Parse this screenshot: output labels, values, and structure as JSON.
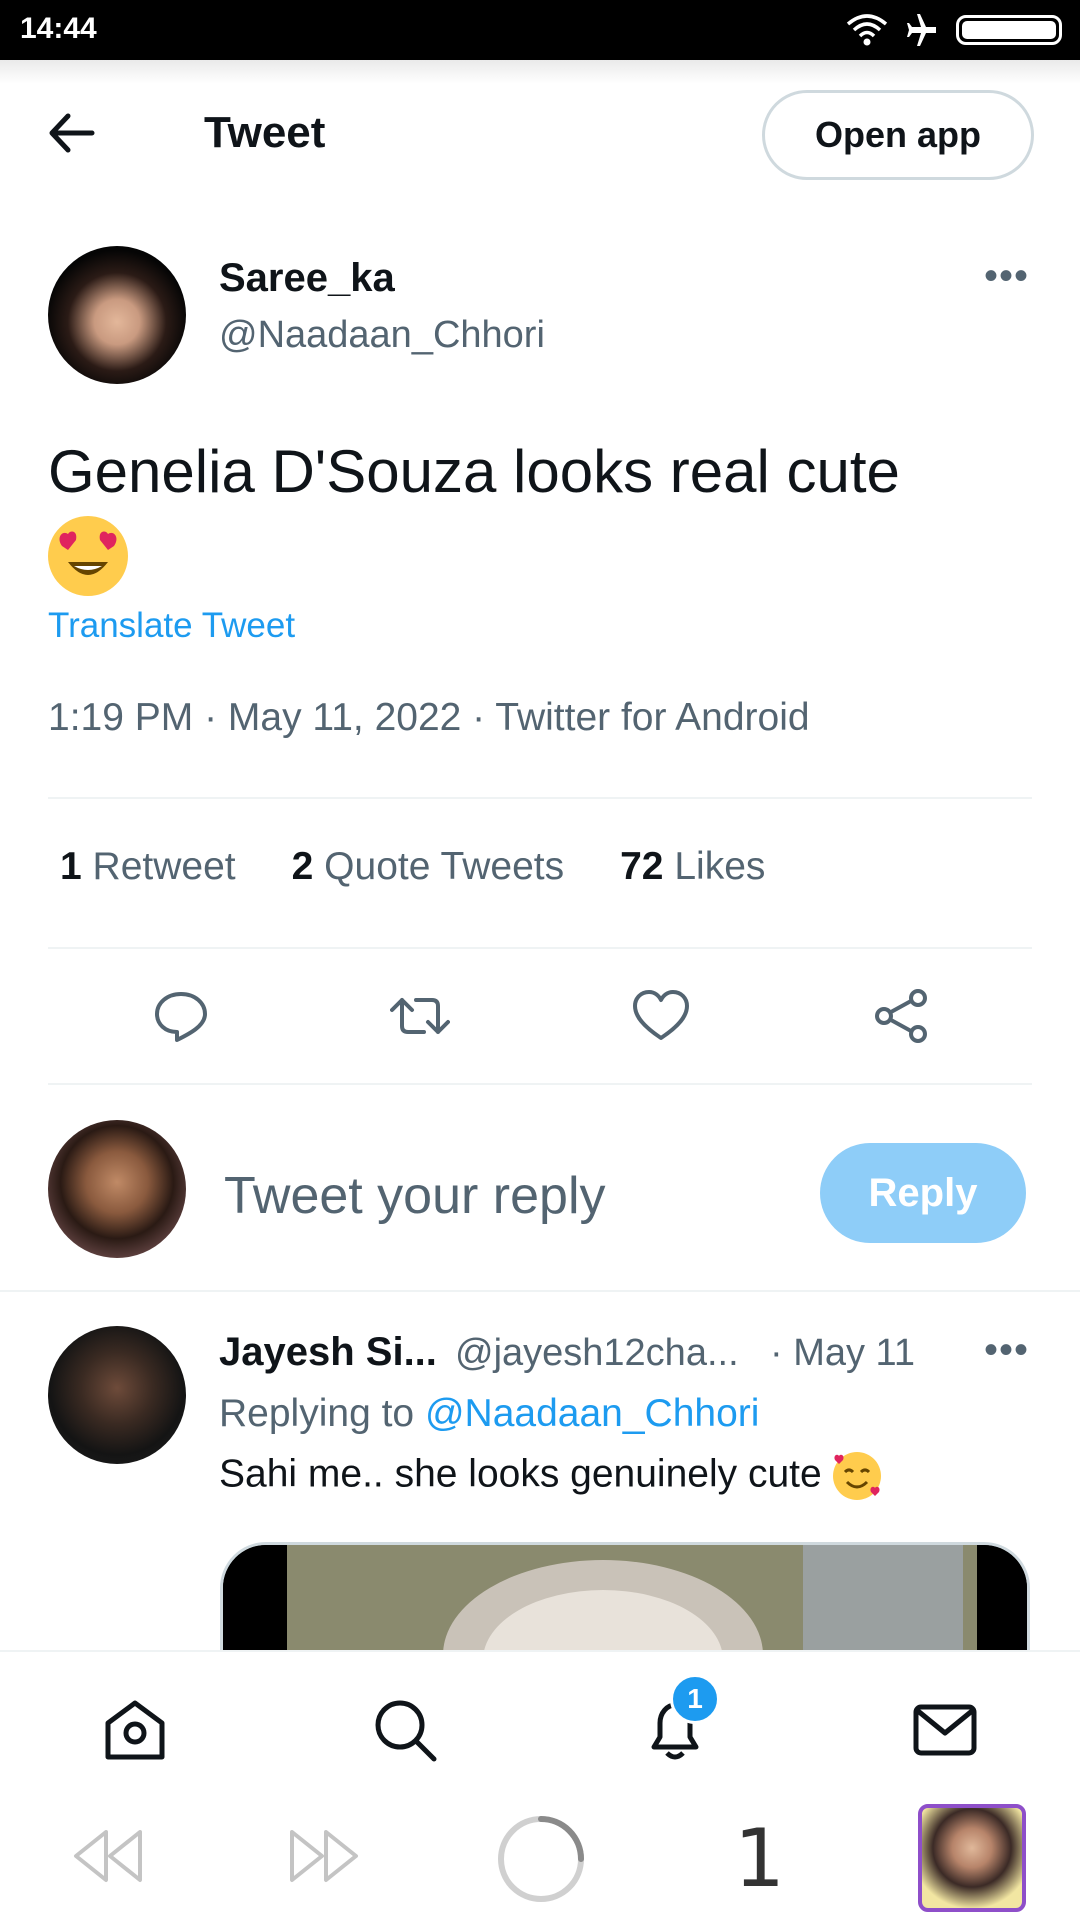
{
  "status_bar": {
    "time": "14:44"
  },
  "header": {
    "title": "Tweet",
    "open_app_label": "Open app"
  },
  "tweet": {
    "author_name": "Saree_ka",
    "author_handle": "@Naadaan_Chhori",
    "text": "Genelia D'Souza looks real cute",
    "translate_label": "Translate Tweet",
    "meta": "1:19 PM · May 11, 2022 · Twitter for Android"
  },
  "stats": {
    "retweets_count": "1",
    "retweets_label": "Retweet",
    "quotes_count": "2",
    "quotes_label": "Quote Tweets",
    "likes_count": "72",
    "likes_label": "Likes"
  },
  "composer": {
    "placeholder": "Tweet your reply",
    "reply_label": "Reply"
  },
  "reply": {
    "name": "Jayesh Si...",
    "handle": "@jayesh12cha...",
    "date": "· May 11",
    "replying_prefix": "Replying to",
    "replying_mention": "@Naadaan_Chhori",
    "text": "Sahi me.. she looks genuinely cute"
  },
  "bottom_nav": {
    "notification_badge": "1"
  },
  "browser": {
    "tab_count": "1"
  },
  "colors": {
    "accent": "#1d9bf0",
    "reply_button": "#8ecdf8",
    "muted_text": "#536471"
  }
}
